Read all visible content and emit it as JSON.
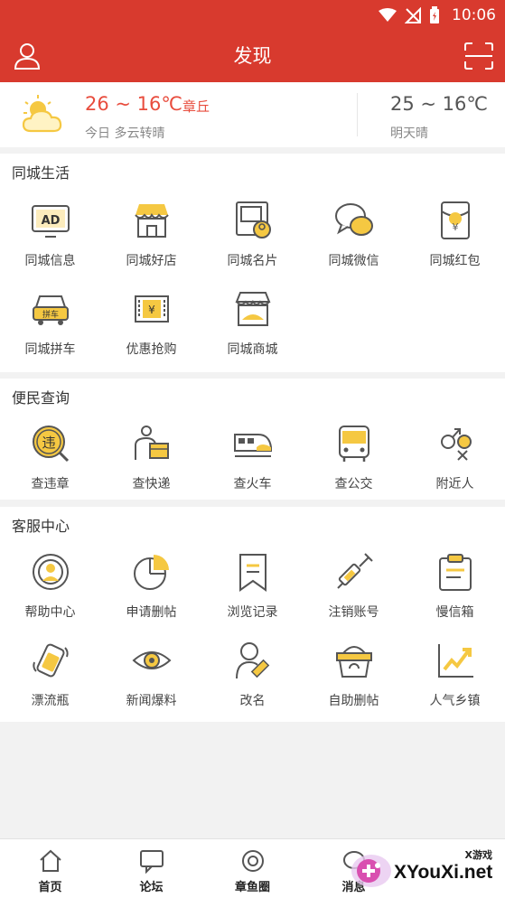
{
  "status_bar": {
    "time": "10:06"
  },
  "header": {
    "title": "发现"
  },
  "weather": {
    "today_temp": "26 ~ 16℃",
    "city": "章丘",
    "today_desc": "今日 多云转晴",
    "tomorrow_temp": "25 ~ 16℃",
    "tomorrow_desc": "明天晴"
  },
  "sections": [
    {
      "title": "同城生活",
      "items": [
        {
          "label": "同城信息",
          "icon": "ad-icon"
        },
        {
          "label": "同城好店",
          "icon": "shop-icon"
        },
        {
          "label": "同城名片",
          "icon": "card-icon"
        },
        {
          "label": "同城微信",
          "icon": "chat-icon"
        },
        {
          "label": "同城红包",
          "icon": "red-packet-icon"
        },
        {
          "label": "同城拼车",
          "icon": "carpool-icon"
        },
        {
          "label": "优惠抢购",
          "icon": "coupon-icon"
        },
        {
          "label": "同城商城",
          "icon": "mall-icon"
        }
      ]
    },
    {
      "title": "便民查询",
      "items": [
        {
          "label": "查违章",
          "icon": "violation-icon"
        },
        {
          "label": "查快递",
          "icon": "courier-icon"
        },
        {
          "label": "查火车",
          "icon": "train-icon"
        },
        {
          "label": "查公交",
          "icon": "bus-icon"
        },
        {
          "label": "附近人",
          "icon": "nearby-icon"
        }
      ]
    },
    {
      "title": "客服中心",
      "items": [
        {
          "label": "帮助中心",
          "icon": "help-icon"
        },
        {
          "label": "申请删帖",
          "icon": "pie-icon"
        },
        {
          "label": "浏览记录",
          "icon": "bookmark-icon"
        },
        {
          "label": "注销账号",
          "icon": "syringe-icon"
        },
        {
          "label": "慢信箱",
          "icon": "clipboard-icon"
        },
        {
          "label": "漂流瓶",
          "icon": "bottle-icon"
        },
        {
          "label": "新闻爆料",
          "icon": "eye-icon"
        },
        {
          "label": "改名",
          "icon": "rename-icon"
        },
        {
          "label": "自助删帖",
          "icon": "basket-icon"
        },
        {
          "label": "人气乡镇",
          "icon": "trend-icon"
        }
      ]
    }
  ],
  "bottom_nav": [
    {
      "label": "首页",
      "icon": "home-icon"
    },
    {
      "label": "论坛",
      "icon": "forum-icon"
    },
    {
      "label": "章鱼圈",
      "icon": "circle-icon"
    },
    {
      "label": "消息",
      "icon": "message-icon"
    }
  ],
  "watermark": {
    "small": "X游戏",
    "big": "XYouXi.net"
  },
  "colors": {
    "brand_red": "#d83a2e",
    "accent_yellow": "#f5c842",
    "icon_dark": "#555555"
  }
}
